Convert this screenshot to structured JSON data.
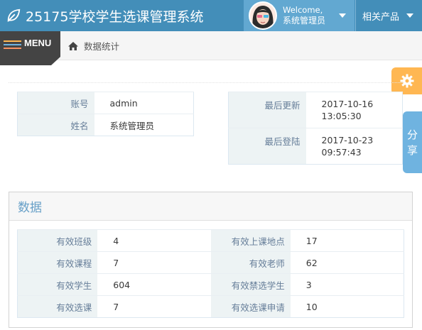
{
  "header": {
    "app_title": "25175学校学生选课管理系统",
    "welcome": "Welcome,",
    "username": "系统管理员",
    "related_menu": "相关产品",
    "colors": {
      "navbar": "#438eb9",
      "user_area": "#62a8d1"
    }
  },
  "nav": {
    "menu_label": "MENU",
    "breadcrumb": "数据统计"
  },
  "floating": {
    "share_label": "分享"
  },
  "account": {
    "rows": [
      {
        "label": "账号",
        "value": "admin"
      },
      {
        "label": "姓名",
        "value": "系统管理员"
      }
    ]
  },
  "activity": {
    "rows": [
      {
        "label": "最后更新",
        "date": "2017-10-16",
        "time": "13:05:30"
      },
      {
        "label": "最后登陆",
        "date": "2017-10-23",
        "time": "09:57:43"
      }
    ]
  },
  "stats": {
    "title": "数据",
    "rows": [
      {
        "label_a": "有效班级",
        "value_a": "4",
        "label_b": "有效上课地点",
        "value_b": "17"
      },
      {
        "label_a": "有效课程",
        "value_a": "7",
        "label_b": "有效老师",
        "value_b": "62"
      },
      {
        "label_a": "有效学生",
        "value_a": "604",
        "label_b": "有效禁选学生",
        "value_b": "3"
      },
      {
        "label_a": "有效选课",
        "value_a": "7",
        "label_b": "有效选课申请",
        "value_b": "10"
      }
    ]
  },
  "icons": [
    "leaf-icon",
    "avatar",
    "chevron-down-icon",
    "menu-icon",
    "home-icon",
    "gear-icon"
  ]
}
